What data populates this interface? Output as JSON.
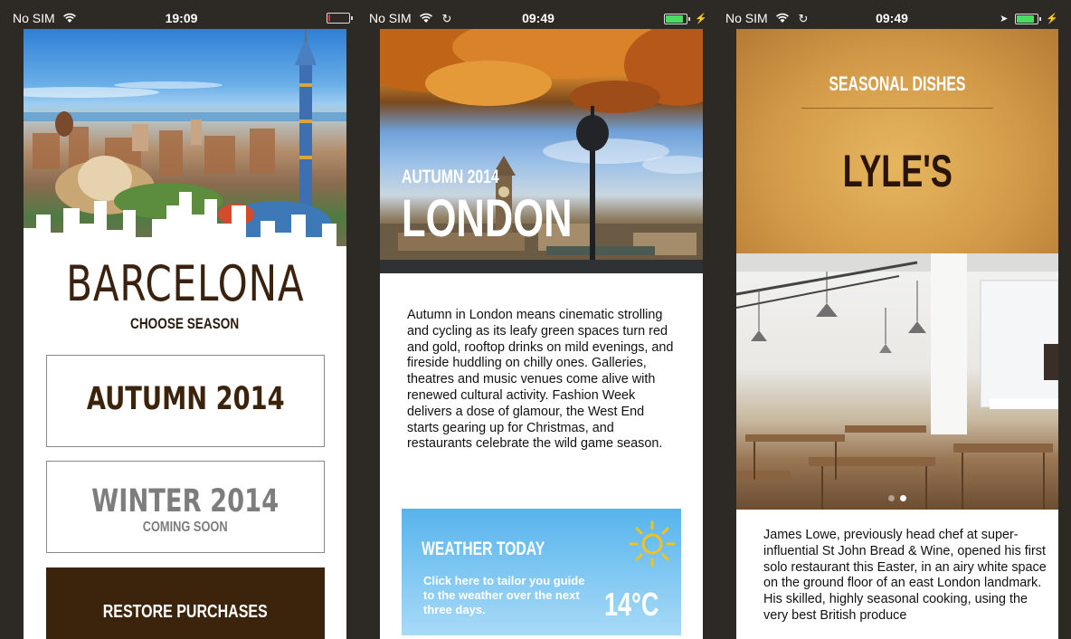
{
  "screens": [
    {
      "status": {
        "carrier": "No SIM",
        "time": "19:09",
        "battery_level": 0.05,
        "battery_color": "#e0303a"
      },
      "city": "BARCELONA",
      "subtitle": "CHOOSE SEASON",
      "seasons": [
        {
          "label": "AUTUMN 2014",
          "note": ""
        },
        {
          "label": "WINTER 2014",
          "note": "COMING SOON"
        }
      ],
      "restore_label": "RESTORE PURCHASES",
      "colors": {
        "brown": "#3c230b",
        "grey": "#7d7d7d"
      }
    },
    {
      "status": {
        "carrier": "No SIM",
        "time": "09:49",
        "battery_level": 0.9,
        "battery_color": "#4cd964"
      },
      "season_label": "AUTUMN 2014",
      "city": "LONDON",
      "body": "Autumn in London means cinematic strolling and cycling as its leafy green spaces turn red and gold, rooftop drinks on mild evenings, and fireside huddling on chilly ones. Galleries, theatres and music venues come alive with renewed cultural activity. Fashion Week delivers a dose of glamour, the West End starts gearing up for Christmas, and restaurants celebrate the wild game season.",
      "weather": {
        "title": "WEATHER TODAY",
        "description": "Click here to tailor you guide to the weather over the next three days.",
        "temperature": "14°C",
        "icon": "sun-icon"
      }
    },
    {
      "status": {
        "carrier": "No SIM",
        "time": "09:49",
        "battery_level": 0.9,
        "battery_color": "#4cd964"
      },
      "category": "SEASONAL DISHES",
      "name": "LYLE'S",
      "body": "James Lowe, previously head chef at super-influential St John Bread & Wine, opened his first solo restaurant this Easter, in an airy white space on the ground floor of an east London landmark. His skilled, highly seasonal cooking, using the very best British produce",
      "carousel": {
        "count": 2,
        "active": 1
      }
    }
  ]
}
